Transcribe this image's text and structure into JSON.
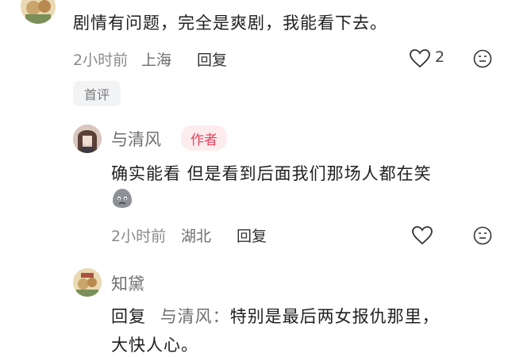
{
  "comments": [
    {
      "text": "剧情有问题，完全是爽剧，我能看下去。",
      "time": "2小时前",
      "location": "上海",
      "reply_label": "回复",
      "likes": "2",
      "tag": "首评"
    },
    {
      "username": "与清风",
      "badge": "作者",
      "text": "确实能看 但是看到后面我们那场人都在笑",
      "sticker": "crying-face-sticker",
      "time": "2小时前",
      "location": "湖北",
      "reply_label": "回复"
    },
    {
      "username": "知黛",
      "reply_prefix": "回复",
      "reply_to": "与清风：",
      "text_line1": "特别是最后两女报仇那里，",
      "text_line2": "大快人心。"
    }
  ],
  "colors": {
    "badge_text": "#e3425b",
    "badge_bg": "#fdecee",
    "meta": "#8a8a8a"
  }
}
